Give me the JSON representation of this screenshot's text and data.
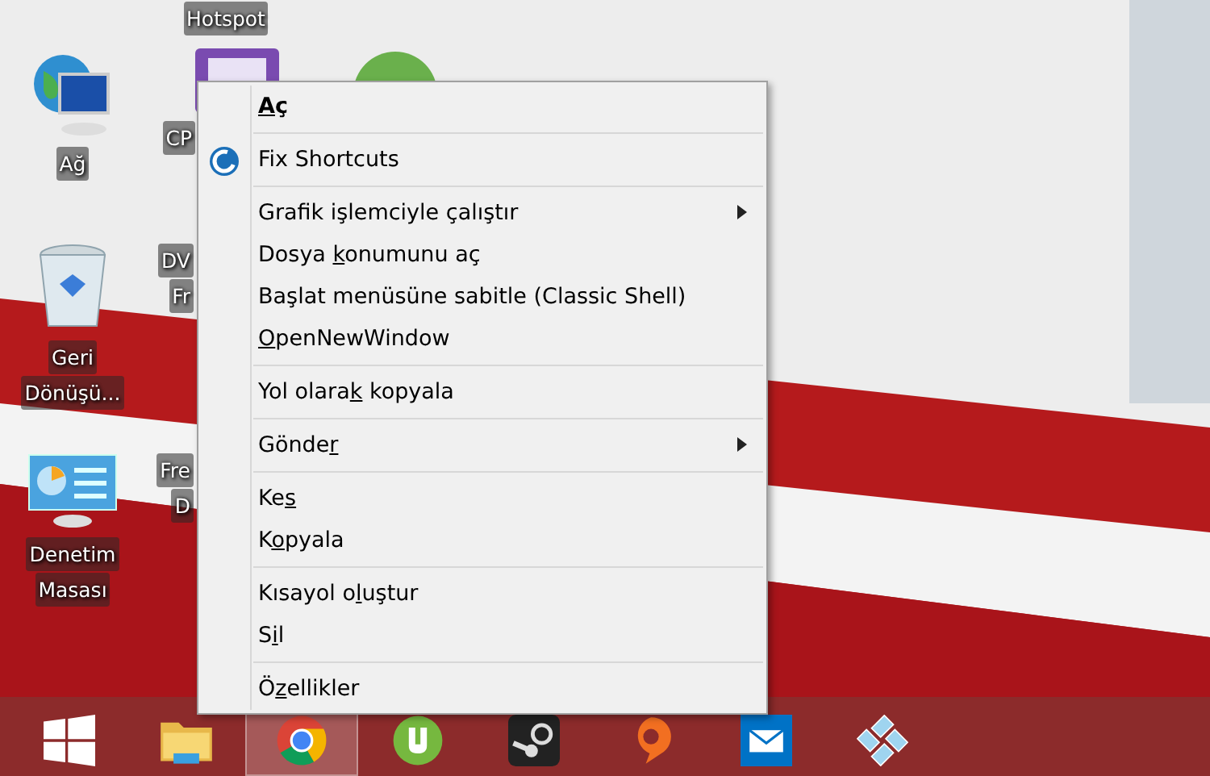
{
  "desktop_icons": [
    {
      "kind": "label-only",
      "lines": [
        "Hotspot"
      ]
    },
    {
      "kind": "network",
      "lines": [
        "Ağ"
      ]
    },
    {
      "kind": "app",
      "lines": [
        "CP"
      ]
    },
    {
      "kind": "green"
    },
    {
      "kind": "recycle",
      "lines": [
        "Geri",
        "Dönüşü..."
      ]
    },
    {
      "kind": "label-only",
      "lines": [
        "DV",
        "Fr"
      ]
    },
    {
      "kind": "control-panel",
      "lines": [
        "Denetim",
        "Masası"
      ]
    },
    {
      "kind": "label-only",
      "lines": [
        "Fre",
        "D"
      ]
    }
  ],
  "context_menu": {
    "groups": [
      [
        {
          "label": [
            {
              "t": "A",
              "u": true
            },
            {
              "t": "ç",
              "u": false
            }
          ],
          "default": true,
          "submenu": false,
          "kind": "plain"
        }
      ],
      [
        {
          "label": [
            {
              "t": "Fix Shortcuts",
              "u": false
            }
          ],
          "default": false,
          "submenu": false,
          "kind": "icon"
        }
      ],
      [
        {
          "label": [
            {
              "t": "Grafik işlemciyle çalıştır",
              "u": false
            }
          ],
          "default": false,
          "submenu": true,
          "kind": "plain"
        },
        {
          "label": [
            {
              "t": "Dosya ",
              "u": false
            },
            {
              "t": "k",
              "u": true
            },
            {
              "t": "onumunu aç",
              "u": false
            }
          ],
          "default": false,
          "submenu": false,
          "kind": "plain"
        },
        {
          "label": [
            {
              "t": "Başlat menüsüne sabitle (Classic Shell)",
              "u": false
            }
          ],
          "default": false,
          "submenu": false,
          "kind": "plain"
        },
        {
          "label": [
            {
              "t": "O",
              "u": true
            },
            {
              "t": "penNewWindow",
              "u": false
            }
          ],
          "default": false,
          "submenu": false,
          "kind": "plain"
        }
      ],
      [
        {
          "label": [
            {
              "t": "Yol olara",
              "u": false
            },
            {
              "t": "k",
              "u": true
            },
            {
              "t": " kopyala",
              "u": false
            }
          ],
          "default": false,
          "submenu": false,
          "kind": "plain"
        }
      ],
      [
        {
          "label": [
            {
              "t": "Gönde",
              "u": false
            },
            {
              "t": "r",
              "u": true
            }
          ],
          "default": false,
          "submenu": true,
          "kind": "plain"
        }
      ],
      [
        {
          "label": [
            {
              "t": "Ke",
              "u": false
            },
            {
              "t": "s",
              "u": true
            }
          ],
          "default": false,
          "submenu": false,
          "kind": "plain"
        },
        {
          "label": [
            {
              "t": "K",
              "u": false
            },
            {
              "t": "o",
              "u": true
            },
            {
              "t": "pyala",
              "u": false
            }
          ],
          "default": false,
          "submenu": false,
          "kind": "plain"
        }
      ],
      [
        {
          "label": [
            {
              "t": "Kısayol o",
              "u": false
            },
            {
              "t": "l",
              "u": true
            },
            {
              "t": "uştur",
              "u": false
            }
          ],
          "default": false,
          "submenu": false,
          "kind": "plain"
        },
        {
          "label": [
            {
              "t": "S",
              "u": false
            },
            {
              "t": "i",
              "u": true
            },
            {
              "t": "l",
              "u": false
            }
          ],
          "default": false,
          "submenu": false,
          "kind": "plain"
        }
      ],
      [
        {
          "label": [
            {
              "t": "Ö",
              "u": false
            },
            {
              "t": "z",
              "u": true
            },
            {
              "t": "ellikler",
              "u": false
            }
          ],
          "default": false,
          "submenu": false,
          "kind": "plain"
        }
      ]
    ]
  },
  "taskbar": {
    "items": [
      {
        "kind": "start",
        "selected": false
      },
      {
        "kind": "folder",
        "selected": false
      },
      {
        "kind": "chrome",
        "selected": true
      },
      {
        "kind": "torrent",
        "selected": false
      },
      {
        "kind": "steam",
        "selected": false
      },
      {
        "kind": "origin",
        "selected": false
      },
      {
        "kind": "mail",
        "selected": false
      },
      {
        "kind": "gamepad",
        "selected": false
      }
    ]
  }
}
